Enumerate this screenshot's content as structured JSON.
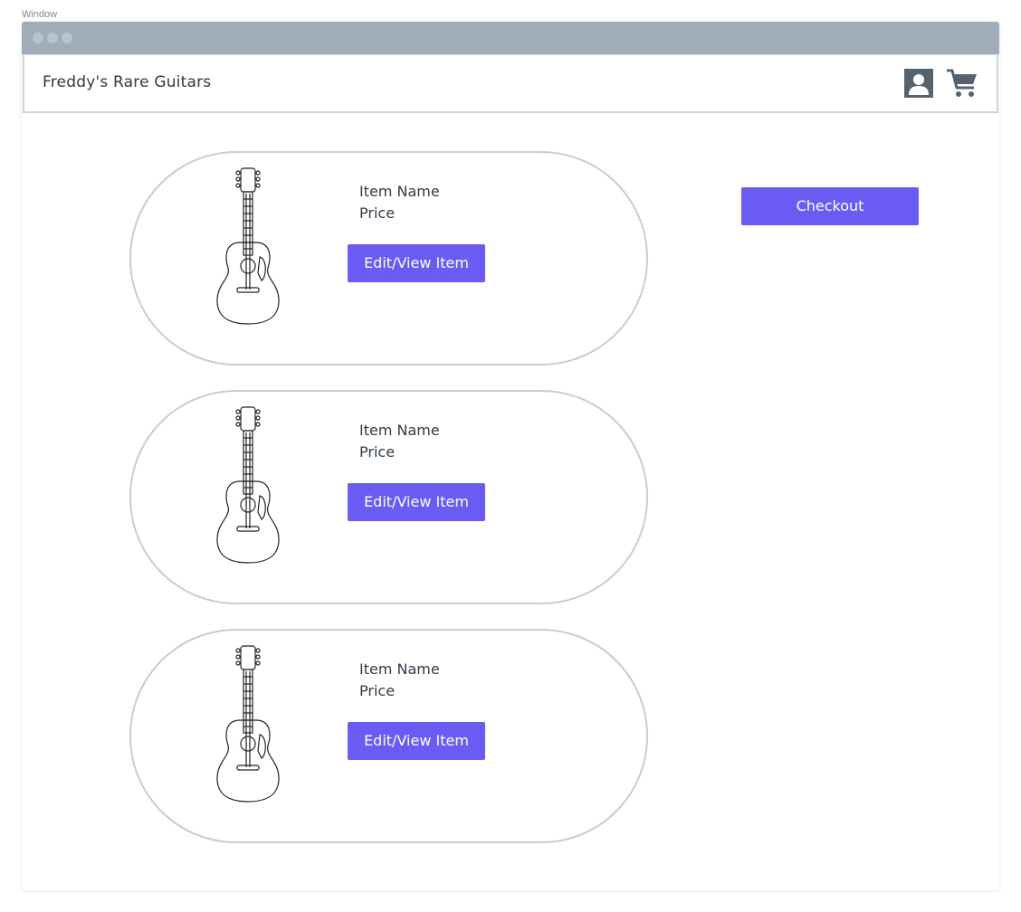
{
  "window_label": "Window",
  "app": {
    "title": "Freddy's Rare Guitars"
  },
  "header_icons": [
    "user-icon",
    "shopping-cart-icon"
  ],
  "items": [
    {
      "name": "Item Name",
      "price": "Price",
      "button": "Edit/View Item",
      "image": "acoustic-guitar"
    },
    {
      "name": "Item Name",
      "price": "Price",
      "button": "Edit/View Item",
      "image": "acoustic-guitar"
    },
    {
      "name": "Item Name",
      "price": "Price",
      "button": "Edit/View Item",
      "image": "acoustic-guitar"
    }
  ],
  "checkout": {
    "label": "Checkout"
  },
  "colors": {
    "accent": "#6a5cf3",
    "titlebar": "#9eadb9",
    "card_border": "#c3ced8",
    "icon": "#556371"
  }
}
